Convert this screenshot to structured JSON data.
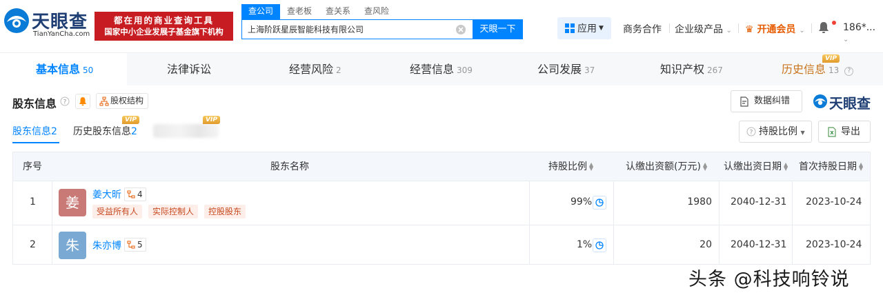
{
  "header": {
    "logo_cn": "天眼查",
    "logo_en": "TianYanCha.com",
    "slogan_line1": "都在用的商业查询工具",
    "slogan_line2": "国家中小企业发展子基金旗下机构",
    "search_tabs": [
      "查公司",
      "查老板",
      "查关系",
      "查风险"
    ],
    "search_value": "上海阶跃星辰智能科技有限公司",
    "search_button": "天眼一下",
    "apps": "应用",
    "business": "商务合作",
    "enterprise": "企业级产品",
    "vip": "开通会员",
    "user": "186*..."
  },
  "tabs": [
    {
      "label": "基本信息",
      "count": "50"
    },
    {
      "label": "法律诉讼",
      "count": ""
    },
    {
      "label": "经营风险",
      "count": "2"
    },
    {
      "label": "经营信息",
      "count": "309"
    },
    {
      "label": "公司发展",
      "count": "37"
    },
    {
      "label": "知识产权",
      "count": "267"
    },
    {
      "label": "历史信息",
      "count": "13"
    }
  ],
  "vip_label": "VIP",
  "section": {
    "title": "股东信息",
    "equity_button": "股权结构",
    "correct_button": "数据纠错",
    "brand": "天眼查",
    "subtabs": [
      {
        "label": "股东信息",
        "count": "2"
      },
      {
        "label": "历史股东信息",
        "count": "2"
      }
    ],
    "ratio_button": "持股比例",
    "export_button": "导出"
  },
  "table": {
    "headers": [
      "序号",
      "股东名称",
      "持股比例",
      "认缴出资额(万元)",
      "认缴出资日期",
      "首次持股日期"
    ],
    "rows": [
      {
        "index": "1",
        "avatar": "姜",
        "avatar_color": "#c97a76",
        "name": "姜大昕",
        "relations": "4",
        "tags": [
          "受益所有人",
          "实际控制人",
          "控股股东"
        ],
        "ratio": "99%",
        "amount": "1980",
        "date": "2040-12-31",
        "first_date": "2023-10-24"
      },
      {
        "index": "2",
        "avatar": "朱",
        "avatar_color": "#7aa9d4",
        "name": "朱亦博",
        "relations": "5",
        "tags": [],
        "ratio": "1%",
        "amount": "20",
        "date": "2040-12-31",
        "first_date": "2023-10-24"
      }
    ]
  },
  "watermark": "头条 @科技响铃说",
  "colors": {
    "brand_blue": "#0084ff",
    "slogan_red": "#c71c22",
    "vip_orange": "#e65c00"
  }
}
